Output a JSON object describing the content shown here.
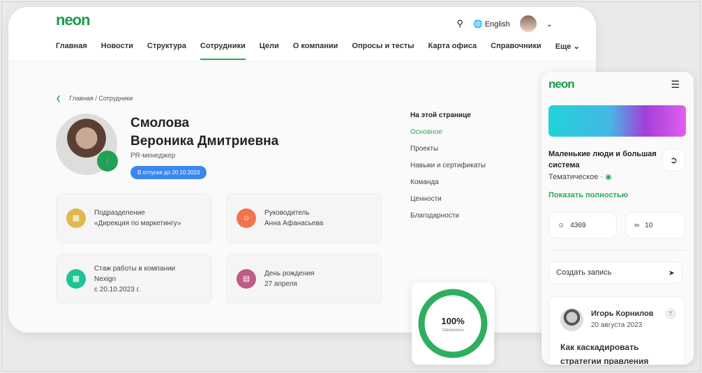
{
  "header": {
    "logo": "neon",
    "language": "English",
    "nav": [
      "Главная",
      "Новости",
      "Структура",
      "Сотрудники",
      "Цели",
      "О компании",
      "Опросы и тесты",
      "Карта офиса",
      "Справочники",
      "Еще"
    ],
    "active_nav": "Сотрудники"
  },
  "breadcrumb": [
    "Главная",
    "/",
    "Сотрудники"
  ],
  "profile": {
    "last_name": "Смолова",
    "first_names": "Вероника Дмитриевна",
    "role": "PR-менеджер",
    "status": "В отпуске до 20.10.2023",
    "status_color": "#3b87f0"
  },
  "cards": [
    {
      "label": "Подразделение",
      "value": "«Дирекция по маркетингу»",
      "icon": "briefcase-icon",
      "color": "#e0b84c"
    },
    {
      "label": "Руководитель",
      "value": "Анна Афанасьева",
      "icon": "user-icon",
      "color": "#f2734d"
    },
    {
      "label": "Стаж работы в компании",
      "value": "Nexign",
      "value2": "с 20.10.2023 г.",
      "icon": "podium-icon",
      "color": "#1fc495"
    },
    {
      "label": "День рождения",
      "value": "27 апреля",
      "icon": "cake-icon",
      "color": "#c05a86"
    }
  ],
  "toc": {
    "title": "На этой странице",
    "items": [
      "Основное",
      "Проекты",
      "Навыки и сертификаты",
      "Команда",
      "Ценности",
      "Благодарности"
    ],
    "active": "Основное"
  },
  "progress": {
    "value": "100%",
    "label": "Завершено",
    "percent": 100
  },
  "mobile": {
    "logo": "neon",
    "title": "Маленькие люди и большая система",
    "category": "Тематическое",
    "show_all": "Показать полностью",
    "members": "4369",
    "links": "10",
    "create_post": "Создать запись",
    "post": {
      "author": "Игорь Корнилов",
      "date": "20 августа 2023",
      "title": "Как каскадировать стратегии правления"
    }
  },
  "accent": "#2aa85a"
}
